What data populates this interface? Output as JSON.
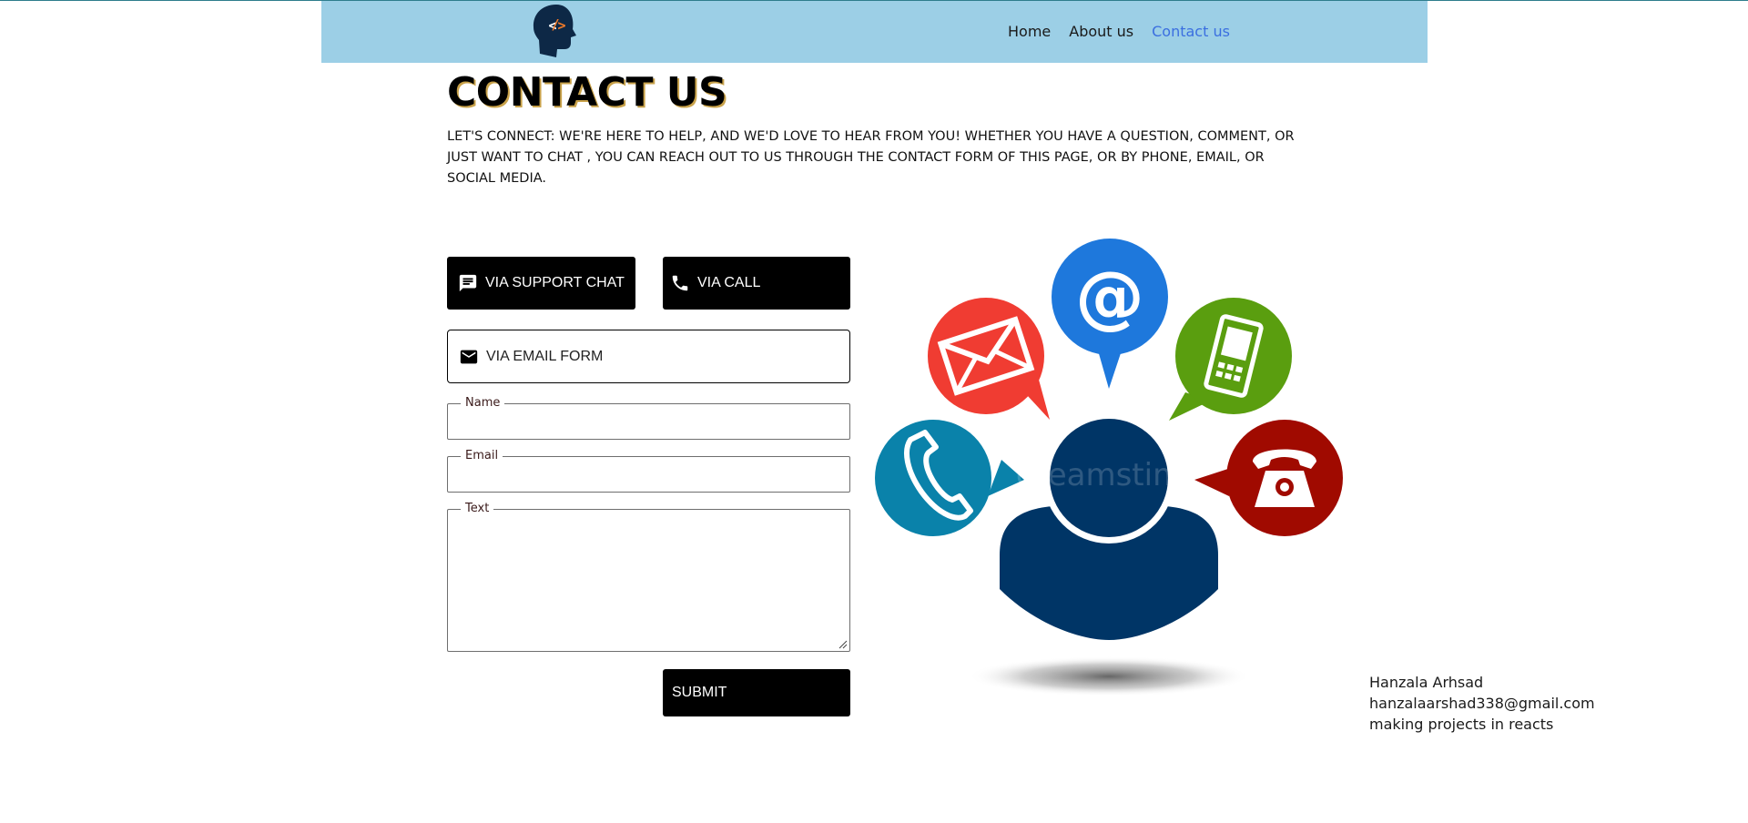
{
  "nav": {
    "links": [
      {
        "label": "Home"
      },
      {
        "label": "About us"
      },
      {
        "label": "Contact us"
      }
    ],
    "active_color": "#3b6fe0",
    "bar_color": "#9ccfe6"
  },
  "page": {
    "title": "CONTACT US",
    "intro": "LET'S CONNECT: WE'RE HERE TO HELP, AND WE'D LOVE TO HEAR FROM YOU! WHETHER YOU HAVE A QUESTION, COMMENT, OR JUST WANT TO CHAT , YOU CAN REACH OUT TO US THROUGH THE CONTACT FORM OF THIS PAGE, OR BY PHONE, EMAIL, OR SOCIAL MEDIA."
  },
  "contact_options": {
    "chat_label": "VIA SUPPORT CHAT",
    "call_label": "VIA CALL",
    "email_label": "VIA EMAIL FORM"
  },
  "form": {
    "name_label": "Name",
    "name_value": "",
    "email_label": "Email",
    "email_value": "",
    "text_label": "Text",
    "text_value": "",
    "submit_label": "SUBMIT"
  },
  "illustration": {
    "watermark": "dreamstime",
    "bubbles": [
      {
        "icon": "at-sign-icon",
        "color": "#1e78dc"
      },
      {
        "icon": "envelope-icon",
        "color": "#f03c32"
      },
      {
        "icon": "mobile-phone-icon",
        "color": "#5a9e0f"
      },
      {
        "icon": "phone-handset-icon",
        "color": "#0a82aa"
      },
      {
        "icon": "telephone-icon",
        "color": "#a00a00"
      }
    ],
    "person_color": "#003566"
  },
  "footer": {
    "name": "Hanzala Arhsad",
    "email": "hanzalaarshad338@gmail.com",
    "tagline": "making projects in reacts"
  }
}
